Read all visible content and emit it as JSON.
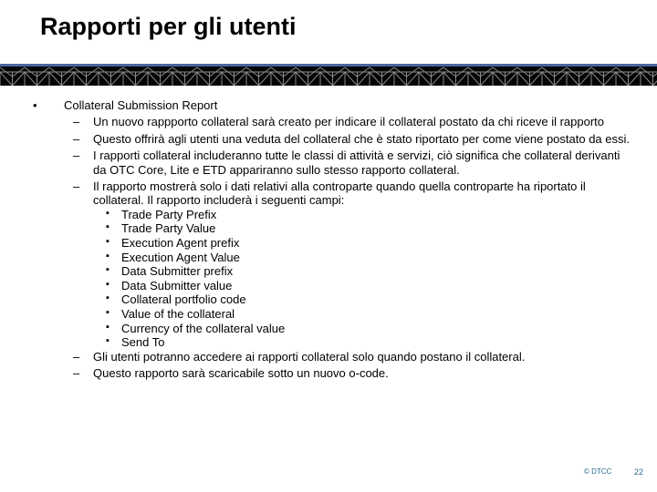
{
  "slide": {
    "title": "Rapporti per gli utenti",
    "bullets": [
      {
        "label": "Collateral Submission Report",
        "sub": [
          "Un nuovo rappporto collateral sarà creato per indicare il collateral postato da chi riceve il rapporto",
          "Questo offrirà agli utenti una veduta del collateral che è stato riportato per come viene postato da essi.",
          "I rapporti collateral includeranno tutte le classi di attività e servizi, ciò significa che collateral derivanti da OTC Core, Lite e ETD appariranno sullo stesso rapporto collateral.",
          "Il rapporto mostrerà solo i dati relativi alla controparte quando quella controparte ha riportato il collateral. Il rapporto includerà i seguenti campi:"
        ],
        "fields": [
          "Trade Party Prefix",
          "Trade Party Value",
          "Execution Agent prefix",
          "Execution Agent Value",
          "Data Submitter prefix",
          "Data Submitter value",
          "Collateral portfolio code",
          "Value of the collateral",
          "Currency of the collateral value",
          "Send To"
        ],
        "after": [
          "Gli utenti potranno accedere ai rapporti collateral solo quando postano il collateral.",
          "Questo rapporto sarà scaricabile sotto un nuovo o-code."
        ]
      }
    ],
    "bullet_glyphs": {
      "level1": "•",
      "level2": "–",
      "level3": "▪"
    }
  },
  "footer": {
    "copyright": "© DTCC",
    "page_number": "22"
  },
  "colors": {
    "band_blue": "#4a66a0",
    "band_black": "#050505",
    "footer_text": "#2a6a8a"
  }
}
